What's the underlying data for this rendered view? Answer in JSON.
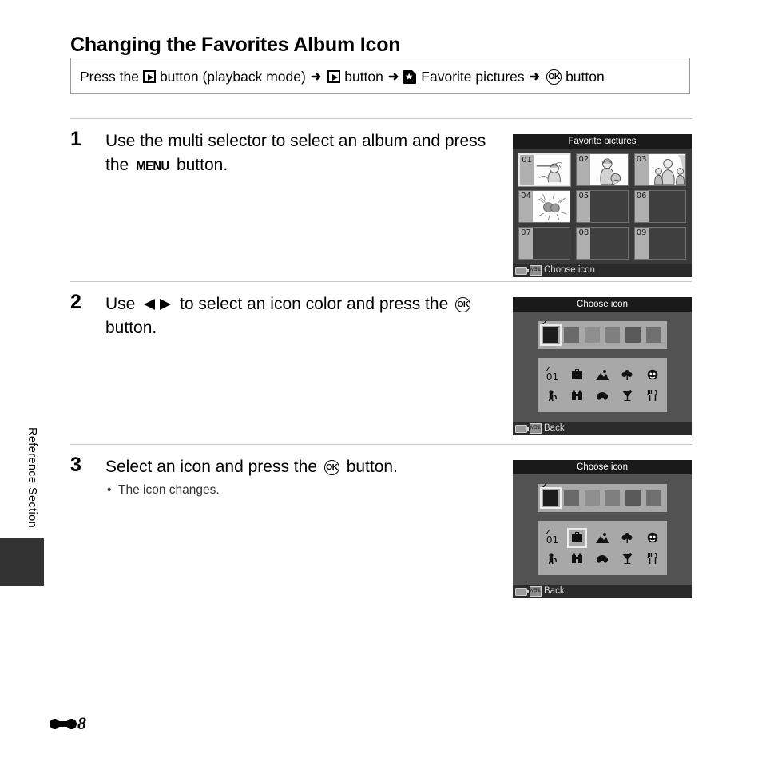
{
  "side_label": "Reference Section",
  "page_title": "Changing the Favorites Album Icon",
  "nav_path": {
    "press_the": "Press the",
    "playback_button_label": "button (playback mode)",
    "arrow": "➜",
    "second_button_label": "button",
    "favorite_pictures_label": "Favorite pictures",
    "ok_button_label": "button",
    "icons": {
      "playback": "playback-icon",
      "favorite": "favorite-pictures-icon",
      "ok": "ok-button-icon"
    }
  },
  "steps": [
    {
      "number": "1",
      "text_before": "Use the multi selector to select an album and press the",
      "inline_key": "MENU",
      "text_after": "button."
    },
    {
      "number": "2",
      "text_before": "Use",
      "text_mid": "to select an icon color and press the",
      "text_after": "button."
    },
    {
      "number": "3",
      "text": "Select an icon and press the",
      "text_after": "button.",
      "bullet": "The icon changes."
    }
  ],
  "screens": {
    "favorite_pictures": {
      "title": "Favorite pictures",
      "footer": "Choose icon",
      "albums": [
        {
          "num": "01",
          "has_photo": true,
          "selected": true
        },
        {
          "num": "02",
          "has_photo": true,
          "selected": false
        },
        {
          "num": "03",
          "has_photo": true,
          "selected": false
        },
        {
          "num": "04",
          "has_photo": true,
          "selected": false
        },
        {
          "num": "05",
          "has_photo": false,
          "selected": false
        },
        {
          "num": "06",
          "has_photo": false,
          "selected": false
        },
        {
          "num": "07",
          "has_photo": false,
          "selected": false
        },
        {
          "num": "08",
          "has_photo": false,
          "selected": false
        },
        {
          "num": "09",
          "has_photo": false,
          "selected": false
        }
      ]
    },
    "choose_icon_step2": {
      "title": "Choose icon",
      "footer": "Back",
      "colors": [
        {
          "name": "black",
          "hex": "#1c1c1c",
          "selected": true
        },
        {
          "name": "dark-gray",
          "hex": "#6a6a6a",
          "selected": false
        },
        {
          "name": "light-gray",
          "hex": "#8f8f8f",
          "selected": false
        },
        {
          "name": "mid-gray",
          "hex": "#7e7e7e",
          "selected": false
        },
        {
          "name": "charcoal",
          "hex": "#5a5a5a",
          "selected": false
        },
        {
          "name": "slate",
          "hex": "#707070",
          "selected": false
        }
      ],
      "icons": [
        {
          "name": "album-number-01-icon",
          "glyph": "01",
          "selected": false,
          "is_number": true
        },
        {
          "name": "suitcase-icon",
          "glyph": "ὋC",
          "selected": false
        },
        {
          "name": "mountain-icon",
          "glyph": "⛰",
          "selected": false
        },
        {
          "name": "flower-icon",
          "glyph": "❀",
          "selected": false
        },
        {
          "name": "face-icon",
          "glyph": "☺",
          "selected": false
        },
        {
          "name": "pet-icon",
          "glyph": "ὁ5",
          "selected": false
        },
        {
          "name": "binoculars-icon",
          "glyph": "ἽB",
          "selected": false
        },
        {
          "name": "car-icon",
          "glyph": "Ὡ7",
          "selected": false
        },
        {
          "name": "cocktail-icon",
          "glyph": "ἷ8",
          "selected": false
        },
        {
          "name": "dining-icon",
          "glyph": "ἷ4",
          "selected": false
        }
      ]
    },
    "choose_icon_step3": {
      "title": "Choose icon",
      "footer": "Back",
      "colors": [
        {
          "name": "black",
          "hex": "#1c1c1c",
          "selected": true
        },
        {
          "name": "dark-gray",
          "hex": "#6a6a6a",
          "selected": false
        },
        {
          "name": "light-gray",
          "hex": "#8f8f8f",
          "selected": false
        },
        {
          "name": "mid-gray",
          "hex": "#7e7e7e",
          "selected": false
        },
        {
          "name": "charcoal",
          "hex": "#5a5a5a",
          "selected": false
        },
        {
          "name": "slate",
          "hex": "#707070",
          "selected": false
        }
      ],
      "icons": [
        {
          "name": "album-number-01-icon",
          "glyph": "01",
          "selected": false,
          "is_number": true
        },
        {
          "name": "suitcase-icon",
          "glyph": "ὋC",
          "selected": true
        },
        {
          "name": "mountain-icon",
          "glyph": "⛰",
          "selected": false
        },
        {
          "name": "flower-icon",
          "glyph": "❀",
          "selected": false
        },
        {
          "name": "face-icon",
          "glyph": "☺",
          "selected": false
        },
        {
          "name": "pet-icon",
          "glyph": "ὁ5",
          "selected": false
        },
        {
          "name": "binoculars-icon",
          "glyph": "ἽB",
          "selected": false
        },
        {
          "name": "car-icon",
          "glyph": "Ὡ7",
          "selected": false
        },
        {
          "name": "cocktail-icon",
          "glyph": "ἷ8",
          "selected": false
        },
        {
          "name": "dining-icon",
          "glyph": "ἷ4",
          "selected": false
        }
      ]
    }
  },
  "folio": {
    "section_mark": "reference-section-mark",
    "number": "8"
  }
}
